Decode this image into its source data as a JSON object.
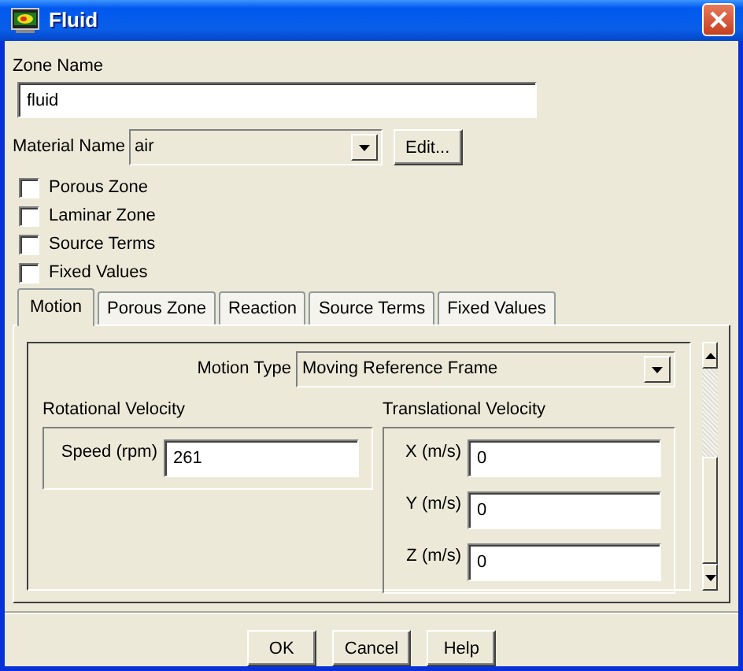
{
  "window": {
    "title": "Fluid"
  },
  "zone_name": {
    "label": "Zone Name",
    "value": "fluid"
  },
  "material": {
    "label": "Material Name",
    "value": "air",
    "edit_button": "Edit..."
  },
  "checkboxes": [
    {
      "label": "Porous Zone",
      "checked": false
    },
    {
      "label": "Laminar Zone",
      "checked": false
    },
    {
      "label": "Source Terms",
      "checked": false
    },
    {
      "label": "Fixed Values",
      "checked": false
    }
  ],
  "tabs": [
    {
      "label": "Motion",
      "selected": true
    },
    {
      "label": "Porous Zone",
      "selected": false
    },
    {
      "label": "Reaction",
      "selected": false
    },
    {
      "label": "Source Terms",
      "selected": false
    },
    {
      "label": "Fixed Values",
      "selected": false
    }
  ],
  "motion_type": {
    "label": "Motion Type",
    "value": "Moving Reference Frame"
  },
  "rotational_velocity": {
    "title": "Rotational Velocity",
    "fields": [
      {
        "label": "Speed (rpm)",
        "value": "261"
      }
    ]
  },
  "translational_velocity": {
    "title": "Translational Velocity",
    "fields": [
      {
        "label": "X (m/s)",
        "value": "0"
      },
      {
        "label": "Y (m/s)",
        "value": "0"
      },
      {
        "label": "Z (m/s)",
        "value": "0"
      }
    ]
  },
  "buttons": [
    "OK",
    "Cancel",
    "Help"
  ]
}
